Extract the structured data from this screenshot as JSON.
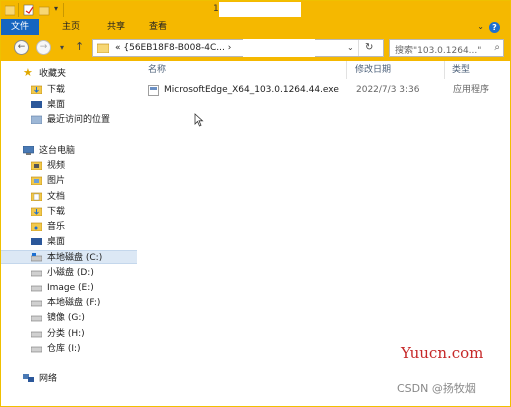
{
  "titlebar": {
    "title": "1"
  },
  "ribbon": {
    "tabs": [
      "文件",
      "主页",
      "共享",
      "查看"
    ]
  },
  "address": {
    "path": "«  {56EB18F8-B008-4C...  ›",
    "search_placeholder": "搜索\"103.0.1264...\""
  },
  "nav": {
    "favorites": "收藏夹",
    "downloads": "下载",
    "desktop": "桌面",
    "recent": "最近访问的位置",
    "thispc": "这台电脑",
    "videos": "视频",
    "pictures": "图片",
    "documents": "文档",
    "downloads2": "下载",
    "music": "音乐",
    "desktop2": "桌面",
    "drive_c": "本地磁盘 (C:)",
    "drive_d": "小磁盘 (D:)",
    "drive_e": "Image (E:)",
    "drive_f": "本地磁盘 (F:)",
    "drive_g": "镜像 (G:)",
    "drive_h": "分类 (H:)",
    "drive_i": "仓库 (I:)",
    "network": "网络"
  },
  "columns": {
    "name": "名称",
    "modified": "修改日期",
    "type": "类型"
  },
  "files": [
    {
      "name": "MicrosoftEdge_X64_103.0.1264.44.exe",
      "modified": "2022/7/3 3:36",
      "type": "应用程序"
    }
  ],
  "watermark": "Yuucn.com",
  "csdn": "CSDN @扬牧烟",
  "colors": {
    "accent": "#f5b800",
    "file_tab": "#1565c0",
    "selected": "#dce8f5"
  }
}
